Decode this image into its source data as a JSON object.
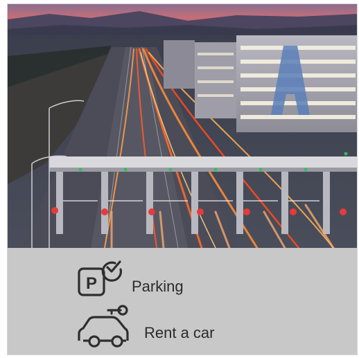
{
  "services": {
    "items": [
      {
        "label": "Parking",
        "icon": "parking-icon"
      },
      {
        "label": "Rent a car",
        "icon": "rent-a-car-icon"
      }
    ]
  },
  "photo": {
    "icon": "airport-parking-toll-photo"
  },
  "colors": {
    "panel": "#c8c8c8",
    "icon_stroke": "#2e2e2e",
    "label": "#2b2b2b"
  }
}
